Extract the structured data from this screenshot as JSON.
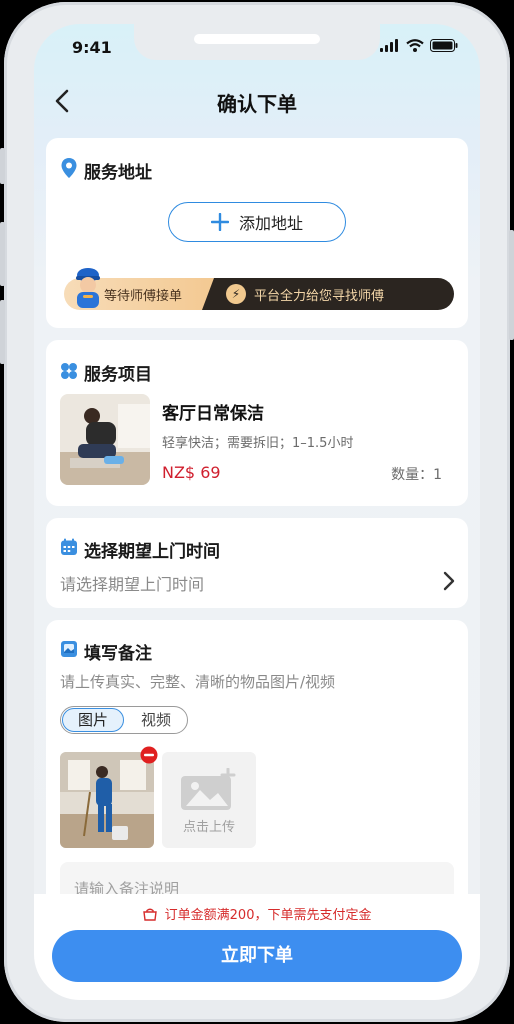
{
  "status_bar": {
    "time": "9:41"
  },
  "header": {
    "title": "确认下单"
  },
  "address": {
    "title": "服务地址",
    "add_label": "添加地址",
    "banner_left": "等待师傅接单",
    "banner_right": "平台全力给您寻找师傅"
  },
  "service": {
    "title": "服务项目",
    "name": "客厅日常保洁",
    "desc": "轻享快洁；需要拆旧；1–1.5小时",
    "price": "NZ$ 69",
    "qty": "数量：1"
  },
  "time": {
    "title": "选择期望上门时间",
    "placeholder": "请选择期望上门时间"
  },
  "notes": {
    "title": "填写备注",
    "hint": "请上传真实、完整、清晰的物品图片/视频",
    "tab_image": "图片",
    "tab_video": "视频",
    "upload_label": "点击上传",
    "input_placeholder": "请输入备注说明"
  },
  "bottom": {
    "notice": "订单金额满200，下单需先支付定金",
    "submit": "立即下单"
  },
  "colors": {
    "accent": "#3d8ef0",
    "price": "#d01f2e",
    "notice": "#d62c2c"
  }
}
